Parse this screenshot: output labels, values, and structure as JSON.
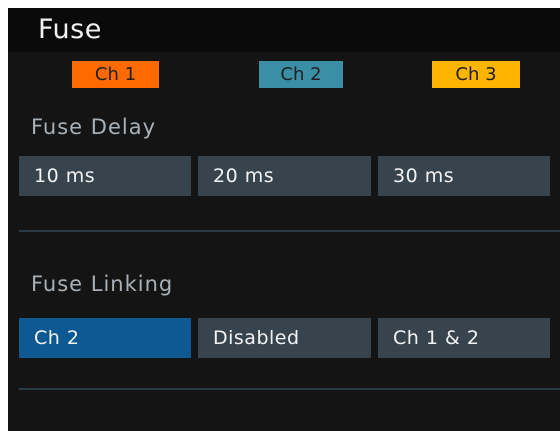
{
  "title": "Fuse",
  "channels": [
    {
      "label": "Ch 1",
      "color": "#ff6a00"
    },
    {
      "label": "Ch 2",
      "color": "#3a8fa6"
    },
    {
      "label": "Ch 3",
      "color": "#ffb400"
    }
  ],
  "fuse_delay": {
    "label": "Fuse Delay",
    "values": [
      "10 ms",
      "20 ms",
      "30 ms"
    ]
  },
  "fuse_linking": {
    "label": "Fuse Linking",
    "values": [
      "Ch 2",
      "Disabled",
      "Ch 1 & 2"
    ],
    "selected_index": 0
  },
  "colors": {
    "background": "#141414",
    "button": "#37434d",
    "button_selected": "#0d5994",
    "label": "#a9b1b8",
    "divider": "#2a3a44"
  }
}
